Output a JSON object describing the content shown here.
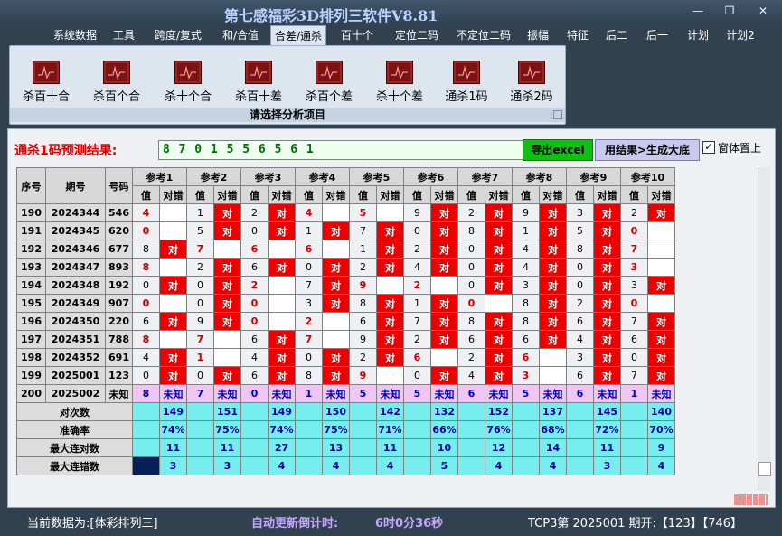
{
  "title": "第七感福彩3D排列三软件V8.81",
  "window_buttons": [
    "—",
    "❐",
    "✕"
  ],
  "menu": [
    "系统数据",
    "工具",
    "跨度/复式",
    "和/合值",
    "合差/通杀",
    "百十个",
    "定位二码",
    "不定位二码",
    "振幅",
    "特征",
    "后二",
    "后一",
    "计划",
    "计划2"
  ],
  "menu_active": 4,
  "ribbon": {
    "buttons": [
      "杀百十合",
      "杀百个合",
      "杀十个合",
      "杀百十差",
      "杀百个差",
      "杀十个差",
      "通杀1码",
      "通杀2码"
    ],
    "caption": "请选择分析项目"
  },
  "prediction": {
    "label": "通杀1码预测结果:",
    "digits": "8 7 0 1 5 5 6 5 6 1",
    "excel_button": "导出excel",
    "generate_button": "用结果>生成大底",
    "pin_checked": "✓",
    "pin_label": "窗体置上"
  },
  "table": {
    "h_index": "序号",
    "h_period": "期号",
    "h_number": "号码",
    "refs": [
      "参考1",
      "参考2",
      "参考3",
      "参考4",
      "参考5",
      "参考6",
      "参考7",
      "参考8",
      "参考9",
      "参考10"
    ],
    "sub_val": "值",
    "sub_ok": "对错",
    "mark": "对",
    "rows": [
      {
        "i": "190",
        "p": "2024344",
        "n": "546",
        "v": [
          "4",
          "1",
          "2",
          "4",
          "5",
          "9",
          "2",
          "9",
          "3",
          "2"
        ],
        "m": [
          0,
          1,
          1,
          0,
          0,
          1,
          1,
          1,
          1,
          1
        ],
        "red": [
          1,
          0,
          0,
          1,
          1,
          0,
          0,
          0,
          0,
          0
        ]
      },
      {
        "i": "191",
        "p": "2024345",
        "n": "620",
        "v": [
          "0",
          "5",
          "0",
          "1",
          "7",
          "0",
          "8",
          "1",
          "5",
          "0"
        ],
        "m": [
          0,
          1,
          1,
          1,
          1,
          1,
          1,
          1,
          1,
          0
        ],
        "red": [
          1,
          0,
          0,
          0,
          0,
          0,
          0,
          0,
          0,
          1
        ]
      },
      {
        "i": "192",
        "p": "2024346",
        "n": "677",
        "v": [
          "8",
          "7",
          "6",
          "6",
          "1",
          "2",
          "0",
          "4",
          "8",
          "7"
        ],
        "m": [
          1,
          0,
          0,
          0,
          1,
          1,
          1,
          1,
          1,
          0
        ],
        "red": [
          0,
          1,
          1,
          1,
          0,
          0,
          0,
          0,
          0,
          1
        ]
      },
      {
        "i": "193",
        "p": "2024347",
        "n": "893",
        "v": [
          "8",
          "2",
          "6",
          "0",
          "2",
          "4",
          "0",
          "4",
          "0",
          "3"
        ],
        "m": [
          0,
          1,
          1,
          1,
          1,
          1,
          1,
          1,
          1,
          0
        ],
        "red": [
          1,
          0,
          0,
          0,
          0,
          0,
          0,
          0,
          0,
          1
        ]
      },
      {
        "i": "194",
        "p": "2024348",
        "n": "192",
        "v": [
          "0",
          "0",
          "2",
          "7",
          "9",
          "2",
          "0",
          "3",
          "0",
          "3"
        ],
        "m": [
          1,
          1,
          0,
          1,
          0,
          0,
          1,
          1,
          1,
          1
        ],
        "red": [
          0,
          0,
          1,
          0,
          1,
          1,
          0,
          0,
          0,
          0
        ]
      },
      {
        "i": "195",
        "p": "2024349",
        "n": "907",
        "v": [
          "0",
          "0",
          "0",
          "3",
          "8",
          "1",
          "0",
          "8",
          "2",
          "0"
        ],
        "m": [
          0,
          1,
          0,
          1,
          1,
          1,
          0,
          1,
          1,
          0
        ],
        "red": [
          1,
          0,
          1,
          0,
          0,
          0,
          1,
          0,
          0,
          1
        ]
      },
      {
        "i": "196",
        "p": "2024350",
        "n": "220",
        "v": [
          "6",
          "9",
          "0",
          "2",
          "6",
          "7",
          "8",
          "8",
          "6",
          "7"
        ],
        "m": [
          1,
          1,
          0,
          0,
          1,
          1,
          1,
          1,
          1,
          1
        ],
        "red": [
          0,
          0,
          1,
          1,
          0,
          0,
          0,
          0,
          0,
          0
        ]
      },
      {
        "i": "197",
        "p": "2024351",
        "n": "788",
        "v": [
          "8",
          "7",
          "6",
          "7",
          "9",
          "2",
          "6",
          "6",
          "4",
          "6"
        ],
        "m": [
          0,
          0,
          1,
          0,
          1,
          1,
          1,
          1,
          1,
          1
        ],
        "red": [
          1,
          1,
          0,
          1,
          0,
          0,
          0,
          0,
          0,
          0
        ]
      },
      {
        "i": "198",
        "p": "2024352",
        "n": "691",
        "v": [
          "4",
          "1",
          "4",
          "0",
          "2",
          "6",
          "2",
          "6",
          "3",
          "0"
        ],
        "m": [
          1,
          0,
          1,
          1,
          1,
          0,
          1,
          0,
          1,
          1
        ],
        "red": [
          0,
          1,
          0,
          0,
          0,
          1,
          0,
          1,
          0,
          0
        ]
      },
      {
        "i": "199",
        "p": "2025001",
        "n": "123",
        "v": [
          "0",
          "0",
          "6",
          "8",
          "9",
          "0",
          "4",
          "3",
          "6",
          "7"
        ],
        "m": [
          1,
          1,
          1,
          1,
          0,
          1,
          1,
          0,
          1,
          1
        ],
        "red": [
          0,
          0,
          0,
          0,
          1,
          0,
          0,
          1,
          0,
          0
        ]
      },
      {
        "i": "200",
        "p": "2025002",
        "n": "未知",
        "v": [
          "8",
          "7",
          "0",
          "1",
          "5",
          "5",
          "6",
          "5",
          "6",
          "1"
        ]
      }
    ],
    "unknown": "未知",
    "stats": [
      {
        "label": "对次数",
        "values": [
          "149",
          "151",
          "149",
          "150",
          "142",
          "132",
          "152",
          "137",
          "145",
          "140"
        ]
      },
      {
        "label": "准确率",
        "values": [
          "74%",
          "75%",
          "74%",
          "75%",
          "71%",
          "66%",
          "76%",
          "68%",
          "72%",
          "70%"
        ]
      },
      {
        "label": "最大连对数",
        "values": [
          "11",
          "11",
          "27",
          "13",
          "11",
          "10",
          "12",
          "14",
          "11",
          "9"
        ]
      },
      {
        "label": "最大连错数",
        "values": [
          "3",
          "3",
          "4",
          "4",
          "4",
          "5",
          "4",
          "4",
          "3",
          "4"
        ]
      }
    ]
  },
  "status": {
    "current_data": "当前数据为:[体彩排列三]",
    "countdown_label": "自动更新倒计时:",
    "countdown_value": "6时0分36秒",
    "draw_info": "TCP3第 2025001 期开:【123】【746】"
  },
  "colors": {
    "hit": "#ee0000",
    "stat": "#77eeee",
    "unknown": "#f1c5f1",
    "excel": "#10c010"
  }
}
